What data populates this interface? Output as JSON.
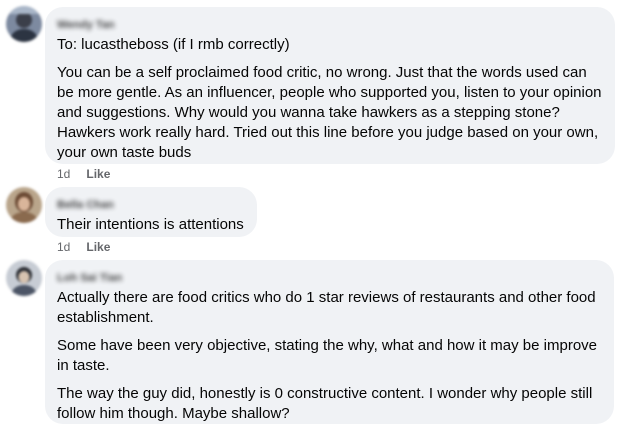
{
  "comments": [
    {
      "author": "Wendy Tan",
      "paragraphs": [
        "To: lucastheboss (if I rmb correctly)",
        "You can be a self proclaimed food critic, no wrong. Just that the words used can be more gentle. As an influencer, people who supported you, listen to your opinion and suggestions. Why would you wanna take hawkers as a stepping stone? Hawkers work really hard. Tried out this line before you judge based on your own, your own taste buds"
      ],
      "time": "1d",
      "like_label": "Like"
    },
    {
      "author": "Bella Chan",
      "paragraphs": [
        "Their intentions is attentions"
      ],
      "time": "1d",
      "like_label": "Like"
    },
    {
      "author": "Loh Sai Tian",
      "paragraphs": [
        "Actually there are food critics who do 1 star reviews of restaurants and other food establishment.",
        "Some have been very objective, stating the why, what and how it may be improve in taste.",
        "The way the guy did, honestly is 0 constructive content. I wonder why people still follow him though. Maybe shallow?"
      ]
    }
  ],
  "colors": {
    "bubble": "#f0f2f5",
    "meta_text": "#65676b",
    "text": "#050505"
  }
}
